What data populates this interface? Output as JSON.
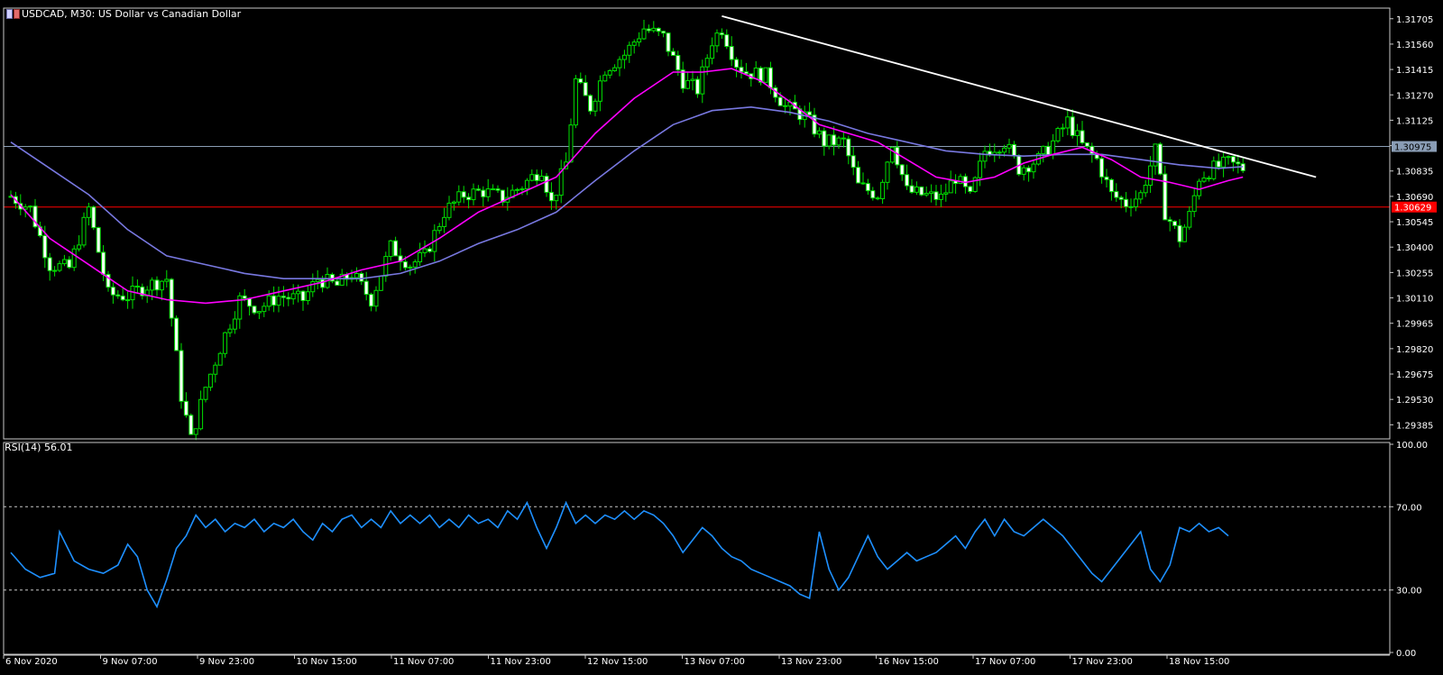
{
  "window": {
    "title": "USDCAD, M30:  US Dollar vs Canadian Dollar"
  },
  "chart_data": [
    {
      "type": "candlestick",
      "symbol": "USDCAD",
      "timeframe": "M30",
      "title": "USDCAD, M30:  US Dollar vs Canadian Dollar",
      "ylim": [
        1.2932,
        1.3177
      ],
      "y_ticks": [
        "1.31705",
        "1.31560",
        "1.31415",
        "1.31270",
        "1.31125",
        "1.30980",
        "1.30835",
        "1.30690",
        "1.30545",
        "1.30400",
        "1.30255",
        "1.30110",
        "1.29965",
        "1.29820",
        "1.29675",
        "1.29530",
        "1.29385"
      ],
      "x_ticks": [
        "6 Nov 2020",
        "9 Nov 07:00",
        "9 Nov 23:00",
        "10 Nov 15:00",
        "11 Nov 07:00",
        "11 Nov 23:00",
        "12 Nov 15:00",
        "13 Nov 07:00",
        "13 Nov 23:00",
        "16 Nov 15:00",
        "17 Nov 07:00",
        "17 Nov 23:00",
        "18 Nov 15:00"
      ],
      "candle_color": "#00e000",
      "close_path": [
        [
          0,
          1.3069
        ],
        [
          4,
          1.3062
        ],
        [
          8,
          1.303
        ],
        [
          12,
          1.3028
        ],
        [
          16,
          1.3062
        ],
        [
          20,
          1.3013
        ],
        [
          24,
          1.3012
        ],
        [
          28,
          1.3018
        ],
        [
          32,
          1.3022
        ],
        [
          35,
          1.2955
        ],
        [
          37,
          1.293
        ],
        [
          40,
          1.296
        ],
        [
          44,
          1.299
        ],
        [
          47,
          1.301
        ],
        [
          51,
          1.3005
        ],
        [
          55,
          1.3012
        ],
        [
          60,
          1.301
        ],
        [
          63,
          1.3022
        ],
        [
          67,
          1.3018
        ],
        [
          70,
          1.3025
        ],
        [
          74,
          1.301
        ],
        [
          78,
          1.304
        ],
        [
          82,
          1.303
        ],
        [
          85,
          1.3035
        ],
        [
          89,
          1.306
        ],
        [
          93,
          1.307
        ],
        [
          97,
          1.3072
        ],
        [
          101,
          1.3068
        ],
        [
          105,
          1.3075
        ],
        [
          109,
          1.3085
        ],
        [
          111,
          1.3065
        ],
        [
          114,
          1.3088
        ],
        [
          116,
          1.3135
        ],
        [
          119,
          1.312
        ],
        [
          122,
          1.3142
        ],
        [
          126,
          1.315
        ],
        [
          130,
          1.3165
        ],
        [
          134,
          1.316
        ],
        [
          138,
          1.3135
        ],
        [
          141,
          1.313
        ],
        [
          144,
          1.3158
        ],
        [
          146,
          1.3165
        ],
        [
          149,
          1.3145
        ],
        [
          151,
          1.314
        ],
        [
          155,
          1.3138
        ],
        [
          159,
          1.312
        ],
        [
          163,
          1.3115
        ],
        [
          167,
          1.31
        ],
        [
          171,
          1.31
        ],
        [
          174,
          1.3075
        ],
        [
          178,
          1.307
        ],
        [
          181,
          1.31
        ],
        [
          184,
          1.3072
        ],
        [
          187,
          1.307
        ],
        [
          191,
          1.3068
        ],
        [
          194,
          1.308
        ],
        [
          197,
          1.3068
        ],
        [
          200,
          1.3095
        ],
        [
          204,
          1.31
        ],
        [
          207,
          1.3085
        ],
        [
          211,
          1.309
        ],
        [
          214,
          1.31
        ],
        [
          217,
          1.3112
        ],
        [
          220,
          1.3098
        ],
        [
          223,
          1.309
        ],
        [
          226,
          1.307
        ],
        [
          229,
          1.3065
        ],
        [
          232,
          1.307
        ],
        [
          235,
          1.3095
        ],
        [
          237,
          1.306
        ],
        [
          240,
          1.3045
        ],
        [
          242,
          1.3058
        ],
        [
          244,
          1.308
        ],
        [
          247,
          1.3085
        ],
        [
          250,
          1.3088
        ],
        [
          253,
          1.3085
        ]
      ],
      "ma_fast": {
        "color": "#ff00ff",
        "points": [
          [
            0,
            1.307
          ],
          [
            8,
            1.3045
          ],
          [
            16,
            1.303
          ],
          [
            24,
            1.3015
          ],
          [
            32,
            1.301
          ],
          [
            40,
            1.3008
          ],
          [
            48,
            1.301
          ],
          [
            56,
            1.3015
          ],
          [
            64,
            1.302
          ],
          [
            72,
            1.3027
          ],
          [
            80,
            1.3032
          ],
          [
            88,
            1.3045
          ],
          [
            96,
            1.306
          ],
          [
            104,
            1.307
          ],
          [
            112,
            1.308
          ],
          [
            120,
            1.3105
          ],
          [
            128,
            1.3125
          ],
          [
            136,
            1.314
          ],
          [
            142,
            1.314
          ],
          [
            148,
            1.3142
          ],
          [
            154,
            1.3135
          ],
          [
            160,
            1.3123
          ],
          [
            166,
            1.311
          ],
          [
            172,
            1.3105
          ],
          [
            178,
            1.31
          ],
          [
            184,
            1.309
          ],
          [
            190,
            1.308
          ],
          [
            196,
            1.3077
          ],
          [
            202,
            1.308
          ],
          [
            208,
            1.3088
          ],
          [
            214,
            1.3093
          ],
          [
            220,
            1.3097
          ],
          [
            226,
            1.309
          ],
          [
            232,
            1.308
          ],
          [
            238,
            1.3077
          ],
          [
            244,
            1.3073
          ],
          [
            250,
            1.3078
          ],
          [
            253,
            1.308
          ]
        ]
      },
      "ma_slow": {
        "color": "#7878e0",
        "points": [
          [
            0,
            1.31
          ],
          [
            8,
            1.3085
          ],
          [
            16,
            1.307
          ],
          [
            24,
            1.305
          ],
          [
            32,
            1.3035
          ],
          [
            40,
            1.303
          ],
          [
            48,
            1.3025
          ],
          [
            56,
            1.3022
          ],
          [
            64,
            1.3022
          ],
          [
            72,
            1.3022
          ],
          [
            80,
            1.3025
          ],
          [
            88,
            1.3032
          ],
          [
            96,
            1.3042
          ],
          [
            104,
            1.305
          ],
          [
            112,
            1.306
          ],
          [
            120,
            1.3078
          ],
          [
            128,
            1.3095
          ],
          [
            136,
            1.311
          ],
          [
            144,
            1.3118
          ],
          [
            152,
            1.312
          ],
          [
            160,
            1.3117
          ],
          [
            168,
            1.3112
          ],
          [
            176,
            1.3105
          ],
          [
            184,
            1.31
          ],
          [
            192,
            1.3095
          ],
          [
            200,
            1.3093
          ],
          [
            208,
            1.3092
          ],
          [
            216,
            1.3093
          ],
          [
            224,
            1.3093
          ],
          [
            232,
            1.309
          ],
          [
            240,
            1.3087
          ],
          [
            248,
            1.3085
          ],
          [
            253,
            1.3086
          ]
        ]
      },
      "trendline": {
        "color": "#ffffff",
        "from": [
          146,
          1.3172
        ],
        "to": [
          268,
          1.308
        ]
      },
      "horizontal_lines": [
        {
          "value": 1.30975,
          "color": "#8a9db5",
          "label": "1.30975"
        },
        {
          "value": 1.30629,
          "color": "#ff0000",
          "label": "1.30629"
        }
      ]
    },
    {
      "type": "line",
      "title": "RSI(14) 56.01",
      "indicator": "RSI",
      "period": 14,
      "current": 56.01,
      "ylim": [
        0,
        100
      ],
      "y_ticks": [
        "100.00",
        "70.00",
        "30.00",
        "0.00"
      ],
      "levels": [
        70,
        30
      ],
      "color": "#1e90ff",
      "points": [
        [
          0,
          48
        ],
        [
          3,
          40
        ],
        [
          6,
          36
        ],
        [
          9,
          38
        ],
        [
          10,
          58
        ],
        [
          13,
          44
        ],
        [
          16,
          40
        ],
        [
          19,
          38
        ],
        [
          22,
          42
        ],
        [
          24,
          52
        ],
        [
          26,
          46
        ],
        [
          28,
          30
        ],
        [
          30,
          22
        ],
        [
          32,
          35
        ],
        [
          34,
          50
        ],
        [
          36,
          56
        ],
        [
          38,
          66
        ],
        [
          40,
          60
        ],
        [
          42,
          64
        ],
        [
          44,
          58
        ],
        [
          46,
          62
        ],
        [
          48,
          60
        ],
        [
          50,
          64
        ],
        [
          52,
          58
        ],
        [
          54,
          62
        ],
        [
          56,
          60
        ],
        [
          58,
          64
        ],
        [
          60,
          58
        ],
        [
          62,
          54
        ],
        [
          64,
          62
        ],
        [
          66,
          58
        ],
        [
          68,
          64
        ],
        [
          70,
          66
        ],
        [
          72,
          60
        ],
        [
          74,
          64
        ],
        [
          76,
          60
        ],
        [
          78,
          68
        ],
        [
          80,
          62
        ],
        [
          82,
          66
        ],
        [
          84,
          62
        ],
        [
          86,
          66
        ],
        [
          88,
          60
        ],
        [
          90,
          64
        ],
        [
          92,
          60
        ],
        [
          94,
          66
        ],
        [
          96,
          62
        ],
        [
          98,
          64
        ],
        [
          100,
          60
        ],
        [
          102,
          68
        ],
        [
          104,
          64
        ],
        [
          106,
          72
        ],
        [
          108,
          60
        ],
        [
          110,
          50
        ],
        [
          112,
          60
        ],
        [
          114,
          72
        ],
        [
          116,
          62
        ],
        [
          118,
          66
        ],
        [
          120,
          62
        ],
        [
          122,
          66
        ],
        [
          124,
          64
        ],
        [
          126,
          68
        ],
        [
          128,
          64
        ],
        [
          130,
          68
        ],
        [
          132,
          66
        ],
        [
          134,
          62
        ],
        [
          136,
          56
        ],
        [
          138,
          48
        ],
        [
          140,
          54
        ],
        [
          142,
          60
        ],
        [
          144,
          56
        ],
        [
          146,
          50
        ],
        [
          148,
          46
        ],
        [
          150,
          44
        ],
        [
          152,
          40
        ],
        [
          154,
          38
        ],
        [
          156,
          36
        ],
        [
          158,
          34
        ],
        [
          160,
          32
        ],
        [
          162,
          28
        ],
        [
          164,
          26
        ],
        [
          166,
          58
        ],
        [
          168,
          40
        ],
        [
          170,
          30
        ],
        [
          172,
          36
        ],
        [
          174,
          46
        ],
        [
          176,
          56
        ],
        [
          178,
          46
        ],
        [
          180,
          40
        ],
        [
          182,
          44
        ],
        [
          184,
          48
        ],
        [
          186,
          44
        ],
        [
          188,
          46
        ],
        [
          190,
          48
        ],
        [
          192,
          52
        ],
        [
          194,
          56
        ],
        [
          196,
          50
        ],
        [
          198,
          58
        ],
        [
          200,
          64
        ],
        [
          202,
          56
        ],
        [
          204,
          64
        ],
        [
          206,
          58
        ],
        [
          208,
          56
        ],
        [
          210,
          60
        ],
        [
          212,
          64
        ],
        [
          214,
          60
        ],
        [
          216,
          56
        ],
        [
          218,
          50
        ],
        [
          220,
          44
        ],
        [
          222,
          38
        ],
        [
          224,
          34
        ],
        [
          226,
          40
        ],
        [
          228,
          46
        ],
        [
          230,
          52
        ],
        [
          232,
          58
        ],
        [
          234,
          40
        ],
        [
          236,
          34
        ],
        [
          238,
          42
        ],
        [
          240,
          60
        ],
        [
          242,
          58
        ],
        [
          244,
          62
        ],
        [
          246,
          58
        ],
        [
          248,
          60
        ],
        [
          250,
          56
        ]
      ]
    }
  ]
}
